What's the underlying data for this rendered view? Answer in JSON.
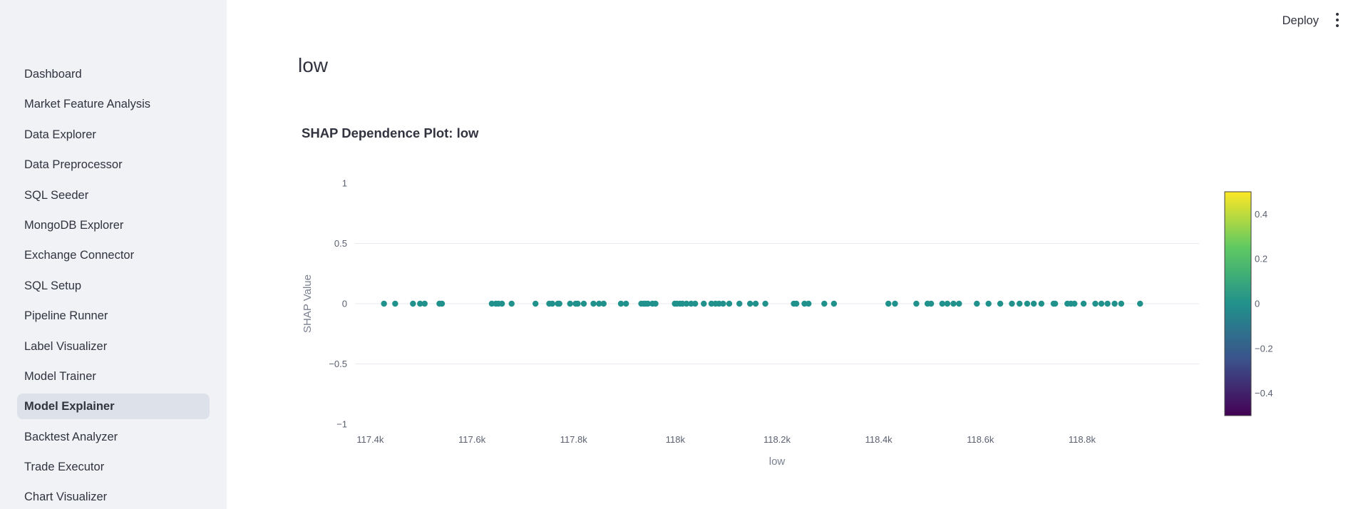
{
  "sidebar": {
    "items": [
      {
        "label": "Dashboard"
      },
      {
        "label": "Market Feature Analysis"
      },
      {
        "label": "Data Explorer"
      },
      {
        "label": "Data Preprocessor"
      },
      {
        "label": "SQL Seeder"
      },
      {
        "label": "MongoDB Explorer"
      },
      {
        "label": "Exchange Connector"
      },
      {
        "label": "SQL Setup"
      },
      {
        "label": "Pipeline Runner"
      },
      {
        "label": "Label Visualizer"
      },
      {
        "label": "Model Trainer"
      },
      {
        "label": "Model Explainer",
        "active": true
      },
      {
        "label": "Backtest Analyzer"
      },
      {
        "label": "Trade Executor"
      },
      {
        "label": "Chart Visualizer"
      }
    ]
  },
  "header": {
    "deploy_label": "Deploy",
    "menu_icon": "kebab-vertical-icon"
  },
  "main": {
    "title": "low"
  },
  "chart_data": {
    "type": "scatter",
    "title": "SHAP Dependence Plot: low",
    "xlabel": "low",
    "ylabel": "SHAP Value",
    "ylim": [
      -1,
      1
    ],
    "xlim": [
      117.37,
      119.03
    ],
    "yticks": [
      {
        "value": 1,
        "label": "1"
      },
      {
        "value": 0.5,
        "label": "0.5"
      },
      {
        "value": 0,
        "label": "0"
      },
      {
        "value": -0.5,
        "label": "−0.5"
      },
      {
        "value": -1,
        "label": "−1"
      }
    ],
    "xticks": [
      {
        "value": 117.4,
        "label": "117.4k"
      },
      {
        "value": 117.6,
        "label": "117.6k"
      },
      {
        "value": 117.8,
        "label": "117.8k"
      },
      {
        "value": 118.0,
        "label": "118k"
      },
      {
        "value": 118.2,
        "label": "118.2k"
      },
      {
        "value": 118.4,
        "label": "118.4k"
      },
      {
        "value": 118.6,
        "label": "118.6k"
      },
      {
        "value": 118.8,
        "label": "118.8k"
      }
    ],
    "grid": true,
    "point_color": "#21918c",
    "x": [
      117.427,
      117.449,
      117.484,
      117.498,
      117.507,
      117.536,
      117.541,
      117.639,
      117.647,
      117.652,
      117.659,
      117.678,
      117.725,
      117.752,
      117.758,
      117.769,
      117.772,
      117.793,
      117.804,
      117.808,
      117.82,
      117.839,
      117.85,
      117.859,
      117.893,
      117.903,
      117.933,
      117.938,
      117.942,
      117.946,
      117.955,
      117.961,
      117.999,
      118.003,
      118.009,
      118.014,
      118.022,
      118.031,
      118.039,
      118.056,
      118.071,
      118.079,
      118.086,
      118.094,
      118.106,
      118.126,
      118.147,
      118.158,
      118.177,
      118.233,
      118.238,
      118.254,
      118.262,
      118.293,
      118.312,
      118.419,
      118.432,
      118.474,
      118.496,
      118.503,
      118.525,
      118.535,
      118.547,
      118.558,
      118.593,
      118.616,
      118.639,
      118.662,
      118.677,
      118.692,
      118.705,
      118.72,
      118.744,
      118.747,
      118.771,
      118.778,
      118.785,
      118.803,
      118.826,
      118.838,
      118.85,
      118.864,
      118.877,
      118.914
    ],
    "colorbar": {
      "range": [
        -0.5,
        0.5
      ],
      "ticks": [
        {
          "value": 0.4,
          "label": "0.4"
        },
        {
          "value": 0.2,
          "label": "0.2"
        },
        {
          "value": 0,
          "label": "0"
        },
        {
          "value": -0.2,
          "label": "−0.2"
        },
        {
          "value": -0.4,
          "label": "−0.4"
        }
      ],
      "colors": [
        "#440154",
        "#3b528b",
        "#21918c",
        "#5ec962",
        "#fde725"
      ]
    }
  }
}
